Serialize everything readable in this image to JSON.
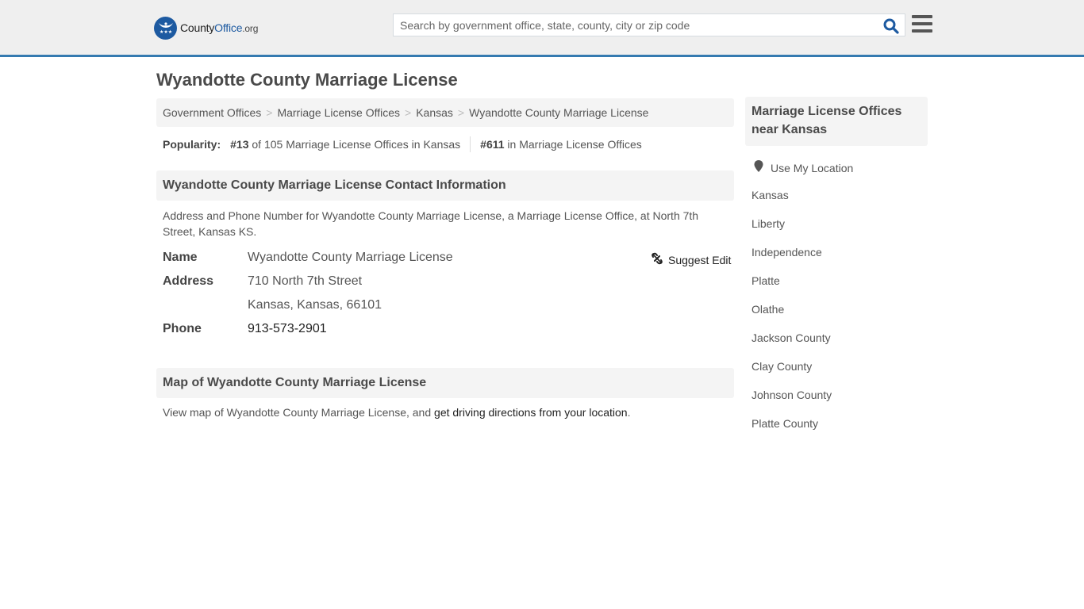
{
  "header": {
    "logo": {
      "brand_part1": "County",
      "brand_part2": "Office",
      "brand_part3": ".org"
    },
    "search": {
      "placeholder": "Search by government office, state, county, city or zip code",
      "value": ""
    },
    "icons": {
      "search": "search-icon",
      "menu": "hamburger-menu-icon"
    }
  },
  "page": {
    "title": "Wyandotte County Marriage License"
  },
  "breadcrumb": [
    {
      "label": "Government Offices"
    },
    {
      "label": "Marriage License Offices"
    },
    {
      "label": "Kansas"
    },
    {
      "label": "Wyandotte County Marriage License"
    }
  ],
  "breadcrumb_separator": ">",
  "popularity": {
    "label": "Popularity:",
    "state_rank": "#13",
    "state_text": "of 105 Marriage License Offices in Kansas",
    "national_rank": "#611",
    "national_text": "in Marriage License Offices"
  },
  "contact": {
    "heading": "Wyandotte County Marriage License Contact Information",
    "description": "Address and Phone Number for Wyandotte County Marriage License, a Marriage License Office, at North 7th Street, Kansas KS.",
    "suggest_edit": "Suggest Edit",
    "rows": [
      {
        "key": "Name",
        "value": "Wyandotte County Marriage License"
      },
      {
        "key": "Address",
        "value": "710 North 7th Street"
      },
      {
        "key": "",
        "value": "Kansas, Kansas, 66101"
      },
      {
        "key": "Phone",
        "value": "913-573-2901"
      }
    ]
  },
  "map": {
    "heading": "Map of Wyandotte County Marriage License",
    "text_prefix": "View map of Wyandotte County Marriage License, and ",
    "link": "get driving directions from your location",
    "text_suffix": "."
  },
  "sidebar": {
    "heading": "Marriage License Offices near Kansas",
    "use_location": "Use My Location",
    "links": [
      "Kansas",
      "Liberty",
      "Independence",
      "Platte",
      "Olathe",
      "Jackson County",
      "Clay County",
      "Johnson County",
      "Platte County"
    ]
  },
  "colors": {
    "accent": "#357ab0",
    "brand": "#1d5aa1",
    "header_bg": "#efefef",
    "panel_bg": "#f4f4f4"
  }
}
